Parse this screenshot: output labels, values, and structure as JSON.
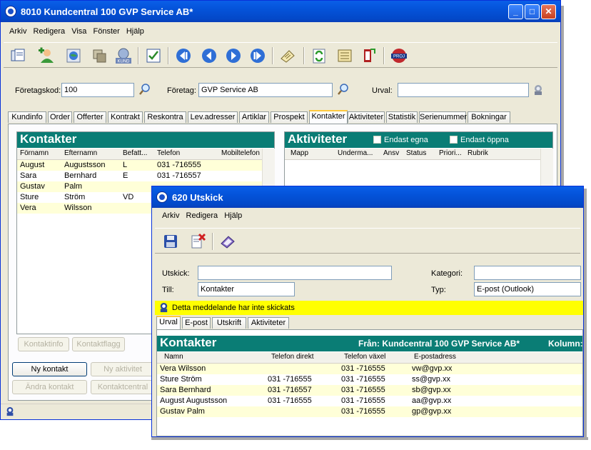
{
  "main_window": {
    "title": "8010 Kundcentral 100 GVP Service AB*",
    "menu": [
      "Arkiv",
      "Redigera",
      "Visa",
      "Fönster",
      "Hjälp"
    ],
    "kund_icon_label": "KUND",
    "proj_icon_label": "PROJ",
    "foretagskod_label": "Företagskod:",
    "foretagskod_value": "100",
    "foretag_label": "Företag:",
    "foretag_value": "GVP Service AB",
    "urval_label": "Urval:",
    "urval_value": "",
    "tabs": [
      "Kundinfo",
      "Order",
      "Offerter",
      "Kontrakt",
      "Reskontra",
      "Lev.adresser",
      "Artiklar",
      "Prospekt",
      "Kontakter",
      "Aktiviteter",
      "Statistik",
      "Serienummer",
      "Bokningar"
    ],
    "active_tab": "Kontakter",
    "kontakter": {
      "title": "Kontakter",
      "columns": [
        "Förnamn",
        "Efternamn",
        "Befatt...",
        "Telefon",
        "Mobiltelefon"
      ],
      "rows": [
        [
          "August",
          "Augustsson",
          "L",
          "031 -716555",
          ""
        ],
        [
          "Sara",
          "Bernhard",
          "E",
          "031 -716557",
          ""
        ],
        [
          "Gustav",
          "Palm",
          "",
          "",
          ""
        ],
        [
          "Sture",
          "Ström",
          "VD",
          "",
          ""
        ],
        [
          "Vera",
          "Wilsson",
          "",
          "",
          ""
        ]
      ]
    },
    "aktiviteter": {
      "title": "Aktiviteter",
      "check_egna": "Endast egna",
      "check_oppna": "Endast öppna",
      "columns": [
        "Mapp",
        "Underma...",
        "Ansv",
        "Status",
        "Priori...",
        "Rubrik"
      ]
    },
    "buttons": {
      "kontaktinfo": "Kontaktinfo",
      "kontaktflagg": "Kontaktflagg",
      "ny_kontakt": "Ny kontakt",
      "ny_aktivitet": "Ny aktivitet",
      "andra_kontakt": "Ändra kontakt",
      "kontaktcentral": "Kontaktcentral"
    }
  },
  "utskick_window": {
    "title": "620 Utskick",
    "menu": [
      "Arkiv",
      "Redigera",
      "Hjälp"
    ],
    "utskick_label": "Utskick:",
    "utskick_value": "",
    "till_label": "Till:",
    "till_value": "Kontakter",
    "kategori_label": "Kategori:",
    "kategori_value": "",
    "typ_label": "Typ:",
    "typ_value": "E-post (Outlook)",
    "notice": "Detta meddelande har inte skickats",
    "tabs": [
      "Urval",
      "E-post",
      "Utskrift",
      "Aktiviteter"
    ],
    "active_tab": "Urval",
    "list": {
      "title": "Kontakter",
      "from_text": "Från: Kundcentral 100 GVP Service AB*",
      "kolumn_text": "Kolumn:",
      "columns": [
        "Namn",
        "Telefon direkt",
        "Telefon växel",
        "E-postadress"
      ],
      "rows": [
        [
          "Vera Wilsson",
          "",
          "031 -716555",
          "vw@gvp.xx"
        ],
        [
          "Sture Ström",
          "031 -716555",
          "031 -716555",
          "ss@gvp.xx"
        ],
        [
          "Sara Bernhard",
          "031 -716557",
          "031 -716555",
          "sb@gvp.xx"
        ],
        [
          "August Augustsson",
          "031 -716555",
          "031 -716555",
          "aa@gvp.xx"
        ],
        [
          "Gustav Palm",
          "",
          "031 -716555",
          "gp@gvp.xx"
        ]
      ]
    }
  },
  "colors": {
    "header_teal": "#0a7d75",
    "title_blue": "#0453d9",
    "row_highlight": "#ffffd8",
    "notice_yellow": "#ffff00"
  }
}
